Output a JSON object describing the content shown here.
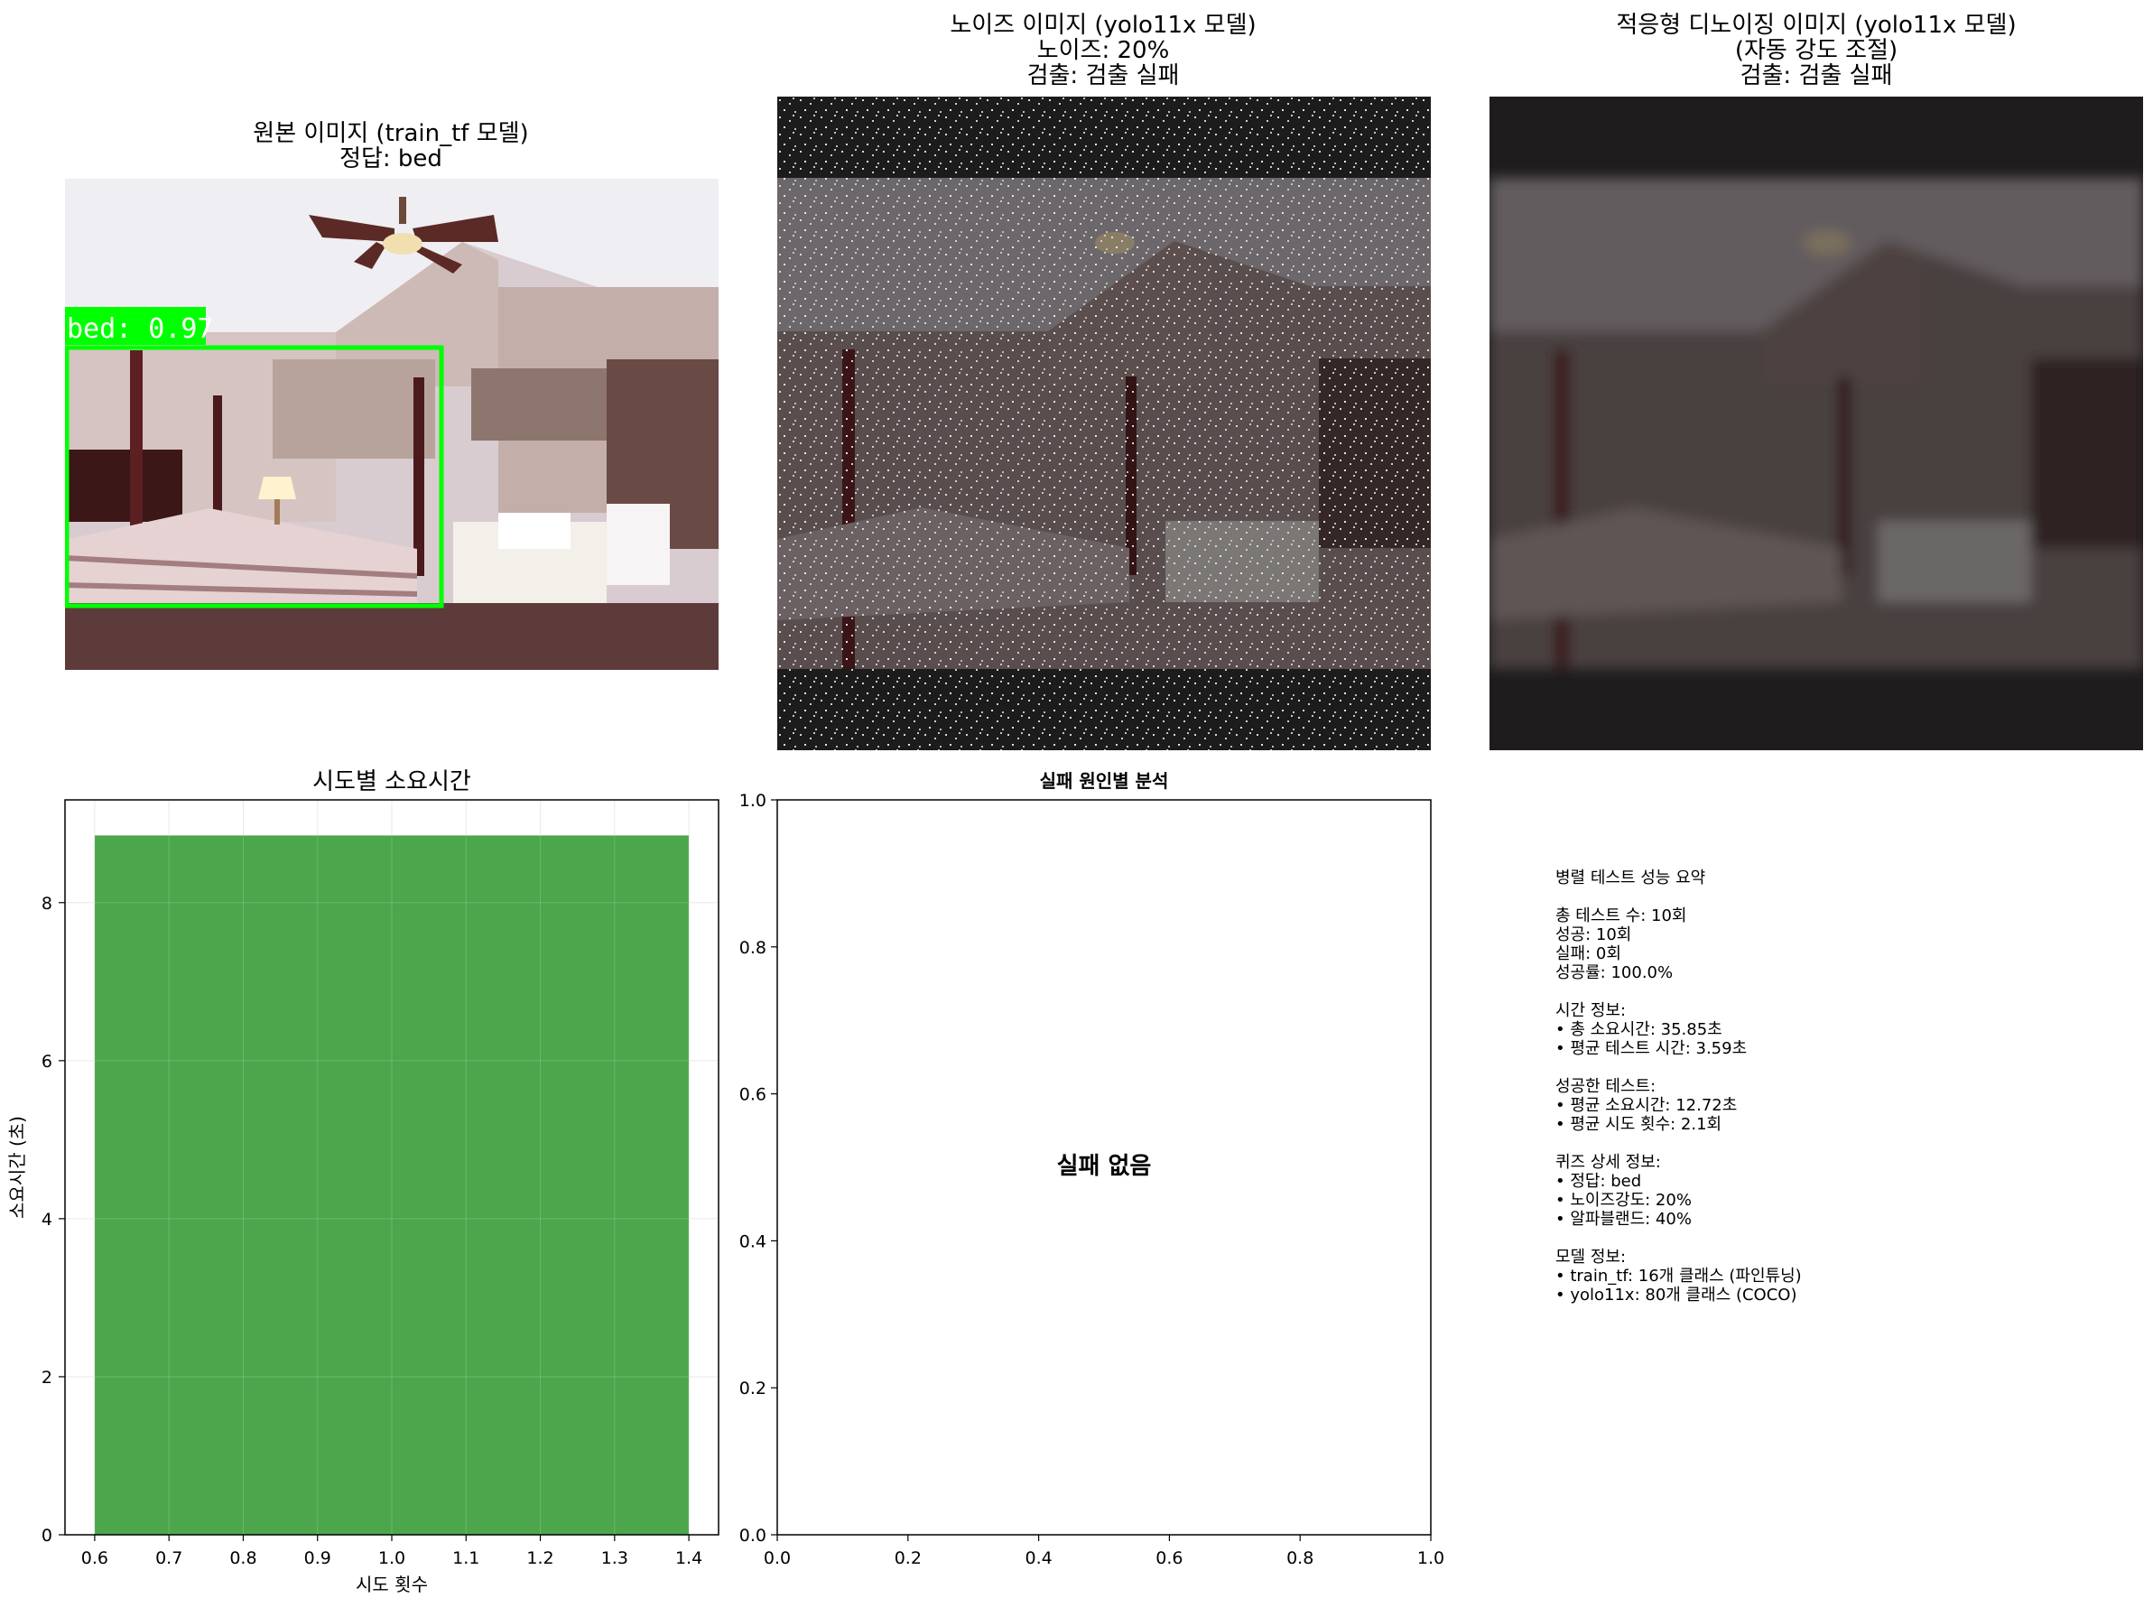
{
  "panels": {
    "original": {
      "title_line1": "원본 이미지 (train_tf 모델)",
      "title_line2": "정답: bed",
      "detection_label": "bed: 0.97",
      "box_color": "#00ff00"
    },
    "noisy": {
      "title_line1": "노이즈 이미지 (yolo11x 모델)",
      "title_line2": "노이즈: 20%",
      "title_line3": "검출: 검출 실패"
    },
    "denoised": {
      "title_line1": "적응형 디노이징 이미지 (yolo11x 모델)",
      "title_line2": "(자동 강도 조절)",
      "title_line3": "검출: 검출 실패"
    },
    "failure": {
      "title": "실패 원인별 분석",
      "message": "실패 없음"
    }
  },
  "chart_data": [
    {
      "type": "bar",
      "title": "시도별 소요시간",
      "xlabel": "시도 횟수",
      "ylabel": "소요시간 (초)",
      "categories": [
        1
      ],
      "values": [
        8.85
      ],
      "bar_width": 0.8,
      "xlim": [
        0.56,
        1.44
      ],
      "ylim": [
        0,
        9.3
      ],
      "xticks": [
        "0.6",
        "0.7",
        "0.8",
        "0.9",
        "1.0",
        "1.1",
        "1.2",
        "1.3",
        "1.4"
      ],
      "yticks": [
        "0",
        "2",
        "4",
        "6",
        "8"
      ],
      "grid": true,
      "color": "#4ca64c"
    },
    {
      "type": "bar",
      "title": "실패 원인별 분석",
      "xlim": [
        0,
        1
      ],
      "ylim": [
        0,
        1
      ],
      "xticks": [
        "0.0",
        "0.2",
        "0.4",
        "0.6",
        "0.8",
        "1.0"
      ],
      "yticks": [
        "0.0",
        "0.2",
        "0.4",
        "0.6",
        "0.8",
        "1.0"
      ],
      "grid": false
    }
  ],
  "summary": {
    "lines": [
      "병렬 테스트 성능 요약",
      "",
      "총 테스트 수: 10회",
      "성공: 10회",
      "실패: 0회",
      "성공률: 100.0%",
      "",
      "시간 정보:",
      "• 총 소요시간: 35.85초",
      "• 평균 테스트 시간: 3.59초",
      "",
      "성공한 테스트:",
      "• 평균 소요시간: 12.72초",
      "• 평균 시도 횟수: 2.1회",
      "",
      "퀴즈 상세 정보:",
      "• 정답: bed",
      "• 노이즈강도: 20%",
      "• 알파블랜드: 40%",
      "",
      "모델 정보:",
      "• train_tf: 16개 클래스 (파인튜닝)",
      "• yolo11x: 80개 클래스 (COCO)"
    ]
  }
}
